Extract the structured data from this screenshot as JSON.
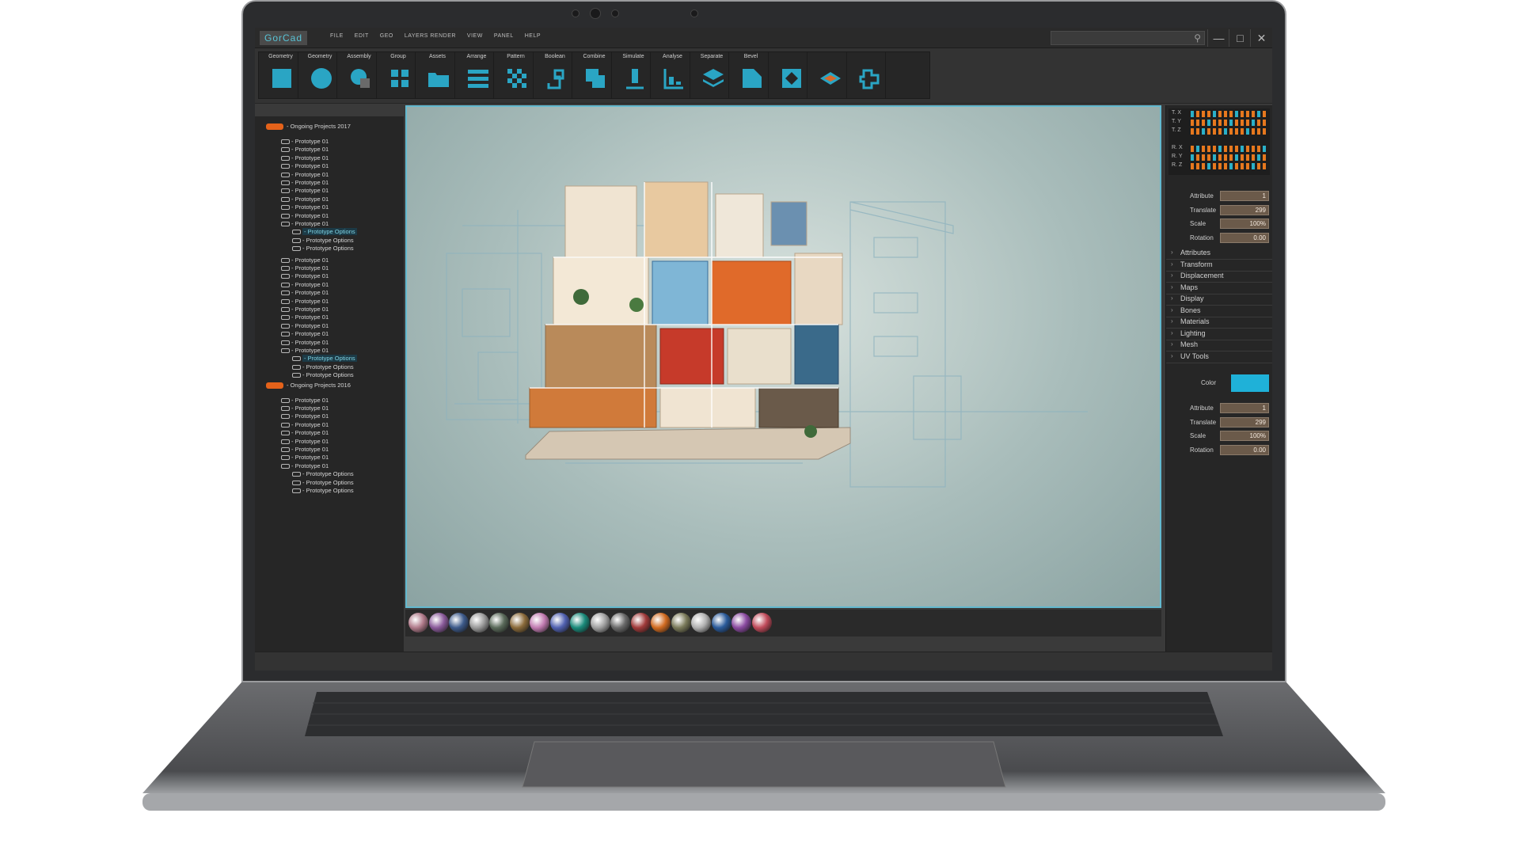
{
  "app": {
    "title": "GorCad",
    "menu": [
      "FILE",
      "EDIT",
      "GEO",
      "LAYERS RENDER",
      "VIEW",
      "PANEL",
      "HELP"
    ]
  },
  "toolbar": {
    "tools": [
      {
        "label": "Geometry",
        "icon": "square-icon"
      },
      {
        "label": "Geometry",
        "icon": "circle-icon"
      },
      {
        "label": "Assembly",
        "icon": "assembly-icon"
      },
      {
        "label": "Group",
        "icon": "grid-icon"
      },
      {
        "label": "Assets",
        "icon": "folder-icon"
      },
      {
        "label": "Arrange",
        "icon": "rows-icon"
      },
      {
        "label": "Pattern",
        "icon": "checker-icon"
      },
      {
        "label": "Boolean",
        "icon": "boolean-icon"
      },
      {
        "label": "Combine",
        "icon": "combine-icon"
      },
      {
        "label": "Simulate",
        "icon": "simulate-icon"
      },
      {
        "label": "Analyse",
        "icon": "analyse-icon"
      },
      {
        "label": "Separate",
        "icon": "layers-icon"
      },
      {
        "label": "Bevel",
        "icon": "bevel-icon"
      },
      {
        "label": "",
        "icon": "diamond-grid-icon"
      },
      {
        "label": "",
        "icon": "plane-icon"
      },
      {
        "label": "",
        "icon": "puzzle-icon"
      },
      {
        "label": "",
        "icon": "empty-slot"
      }
    ]
  },
  "tree": {
    "projects": [
      {
        "name": "- Ongoing Projects 2017",
        "items": [
          "- Prototype 01",
          "- Prototype 01",
          "- Prototype 01",
          "- Prototype 01",
          "- Prototype 01",
          "- Prototype 01",
          "- Prototype 01",
          "- Prototype 01",
          "- Prototype 01",
          "- Prototype 01",
          "- Prototype 01"
        ],
        "options1": [
          "- Prototype Options",
          "- Prototype Options",
          "- Prototype Options"
        ],
        "items2": [
          "- Prototype 01",
          "- Prototype 01",
          "- Prototype 01",
          "- Prototype 01",
          "- Prototype 01",
          "- Prototype 01",
          "- Prototype 01",
          "- Prototype 01",
          "- Prototype 01",
          "- Prototype 01",
          "- Prototype 01",
          "- Prototype 01"
        ],
        "options2": [
          "- Prototype Options",
          "- Prototype Options",
          "- Prototype Options"
        ]
      },
      {
        "name": "- Ongoing Projects 2016",
        "items": [
          "- Prototype 01",
          "- Prototype 01",
          "- Prototype 01",
          "- Prototype 01",
          "- Prototype 01",
          "- Prototype 01",
          "- Prototype 01",
          "- Prototype 01",
          "- Prototype 01"
        ],
        "options": [
          "- Prototype Options",
          "- Prototype Options",
          "- Prototype Options"
        ]
      }
    ]
  },
  "timeline": {
    "rows": [
      "T. X",
      "T. Y",
      "T. Z",
      "R. X",
      "R. Y",
      "R. Z"
    ]
  },
  "props_top": [
    {
      "label": "Attribute",
      "value": "1"
    },
    {
      "label": "Translate",
      "value": "299"
    },
    {
      "label": "Scale",
      "value": "100%"
    },
    {
      "label": "Rotation",
      "value": "0.00"
    }
  ],
  "sections": [
    "Attributes",
    "Transform",
    "Displacement",
    "Maps",
    "Display",
    "Bones",
    "Materials",
    "Lighting",
    "Mesh",
    "UV Tools"
  ],
  "color_label": "Color",
  "props_bottom": [
    {
      "label": "Attribute",
      "value": "1"
    },
    {
      "label": "Translate",
      "value": "299"
    },
    {
      "label": "Scale",
      "value": "100%"
    },
    {
      "label": "Rotation",
      "value": "0.00"
    }
  ],
  "colors": {
    "accent": "#58c3d6",
    "orange": "#e4621a",
    "color_swatch": "#1fb1d8"
  },
  "materials": [
    "#b07a8a",
    "#8a5a9a",
    "#3d5a8a",
    "#9a9a9a",
    "#5a6a5a",
    "#8a6a3a",
    "#c07ab0",
    "#5060b0",
    "#1a8a7a",
    "#a0a0a0",
    "#6a6a6a",
    "#a03a3a",
    "#d06a20",
    "#7a7a5a",
    "#b0b0b0",
    "#2a5a9a",
    "#8a4aa0",
    "#c04a5a"
  ],
  "viewport": {
    "label": "3D model viewport"
  }
}
